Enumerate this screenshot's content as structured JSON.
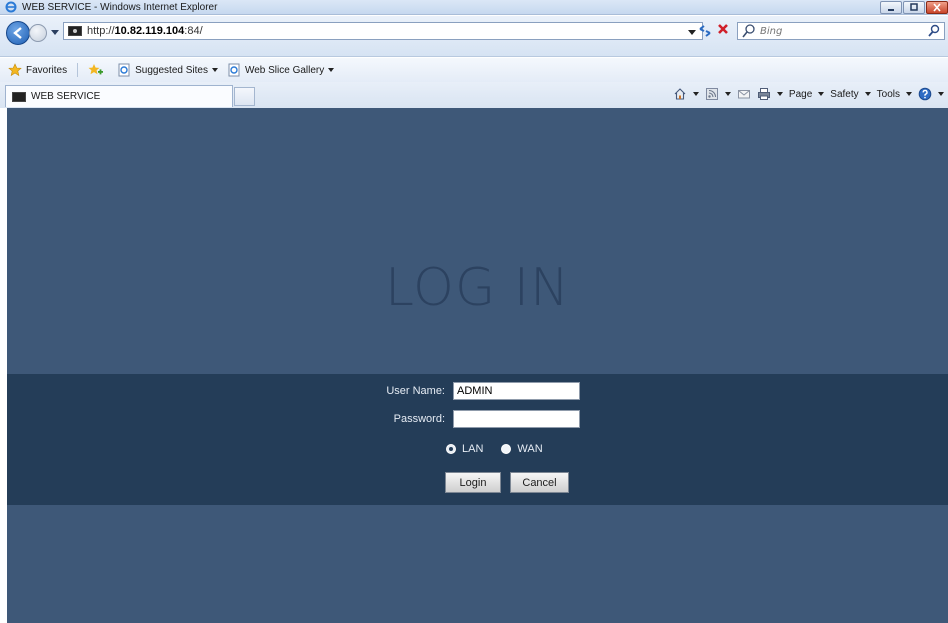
{
  "window": {
    "title": "WEB SERVICE - Windows Internet Explorer",
    "controls": [
      "minimize-icon",
      "maximize-icon",
      "close-icon"
    ]
  },
  "address_bar": {
    "url_prefix": "http://",
    "url_host": "10.82.119.104",
    "url_suffix": ":84/",
    "search_placeholder": "Bing"
  },
  "favorites_bar": {
    "favorites_label": "Favorites",
    "items": [
      {
        "label": "Suggested Sites",
        "icon": "ie-page-icon"
      },
      {
        "label": "Web Slice Gallery",
        "icon": "ie-page-icon"
      }
    ]
  },
  "tabs": {
    "active_label": "WEB SERVICE"
  },
  "command_bar": {
    "page_label": "Page",
    "safety_label": "Safety",
    "tools_label": "Tools"
  },
  "page": {
    "title": "LOG IN",
    "username_label": "User Name:",
    "username_value": "ADMIN",
    "password_label": "Password:",
    "password_value": "",
    "network_options": [
      {
        "label": "LAN",
        "selected": true
      },
      {
        "label": "WAN",
        "selected": false
      }
    ],
    "login_button": "Login",
    "cancel_button": "Cancel"
  },
  "colors": {
    "page_background": "#3e5878",
    "login_band": "#243d58",
    "title_text": "#2c4260",
    "chrome": "#dbe7f6"
  }
}
